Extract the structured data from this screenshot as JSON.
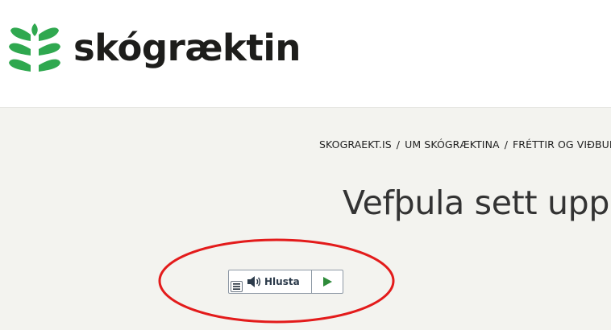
{
  "header": {
    "logo_text": "skógræktin",
    "logo_icon": "tree-leaves-logo",
    "brand_color": "#2fa84f"
  },
  "breadcrumb": {
    "items": [
      "SKOGRAEKT.IS",
      "UM SKÓGRÆKTINA",
      "FRÉTTIR OG VIÐBUR"
    ],
    "separator": "/"
  },
  "page": {
    "title": "Vefþula sett upp"
  },
  "player": {
    "menu_icon": "menu-lines-icon",
    "speaker_icon": "speaker-icon",
    "listen_label": "Hlusta",
    "play_icon": "play-icon",
    "play_color": "#2e8b3a"
  },
  "annotation": {
    "color": "#e31b1b"
  }
}
